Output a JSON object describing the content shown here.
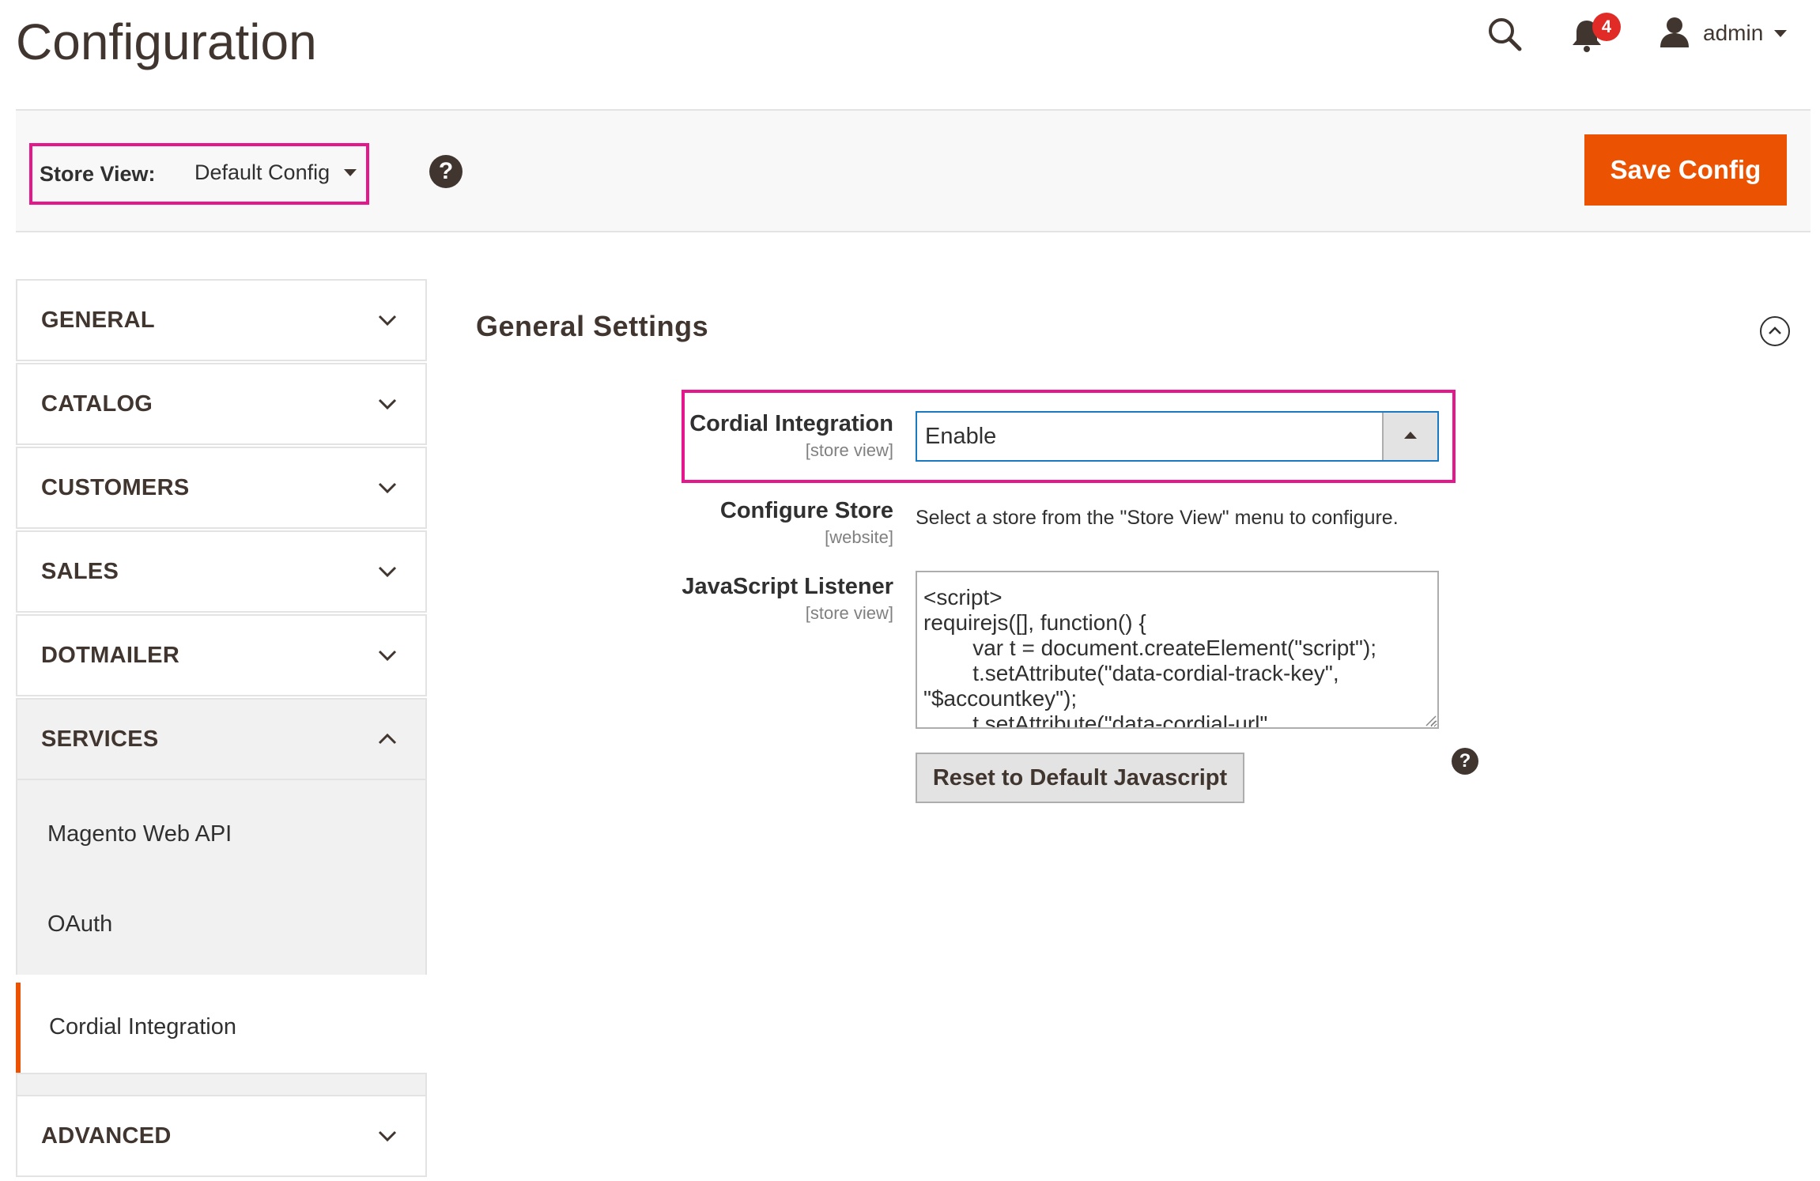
{
  "header": {
    "title": "Configuration",
    "notification_count": "4",
    "user_name": "admin",
    "icons": {
      "search": "search-icon",
      "notifications": "bell-icon",
      "user": "user-icon"
    }
  },
  "toolbar": {
    "store_view_label": "Store View:",
    "store_view_value": "Default Config",
    "help_symbol": "?",
    "save_label": "Save Config"
  },
  "sidebar": {
    "items": [
      {
        "label": "GENERAL",
        "expanded": false
      },
      {
        "label": "CATALOG",
        "expanded": false
      },
      {
        "label": "CUSTOMERS",
        "expanded": false
      },
      {
        "label": "SALES",
        "expanded": false
      },
      {
        "label": "DOTMAILER",
        "expanded": false
      },
      {
        "label": "SERVICES",
        "expanded": true
      },
      {
        "label": "ADVANCED",
        "expanded": false
      }
    ],
    "services_children": [
      {
        "label": "Magento Web API",
        "active": false
      },
      {
        "label": "OAuth",
        "active": false
      },
      {
        "label": "Cordial Integration",
        "active": true
      }
    ]
  },
  "main": {
    "section_title": "General Settings",
    "fields": {
      "cordial_integration": {
        "label": "Cordial Integration",
        "scope": "[store view]",
        "value": "Enable"
      },
      "configure_store": {
        "label": "Configure Store",
        "scope": "[website]",
        "note": "Select a store from the \"Store View\" menu to configure."
      },
      "javascript_listener": {
        "label": "JavaScript Listener",
        "scope": "[store view]",
        "value": "<script>\nrequirejs([], function() {\n        var t = document.createElement(\"script\");\n        t.setAttribute(\"data-cordial-track-key\",\n\"$accountkey\");\n        t.setAttribute(\"data-cordial-url\","
      },
      "reset_label": "Reset to Default Javascript",
      "help_symbol": "?"
    }
  },
  "colors": {
    "accent": "#eb5202",
    "highlight": "#e5178d",
    "text_dark": "#41362f",
    "badge": "#e02b27",
    "focus_border": "#1979c3"
  }
}
